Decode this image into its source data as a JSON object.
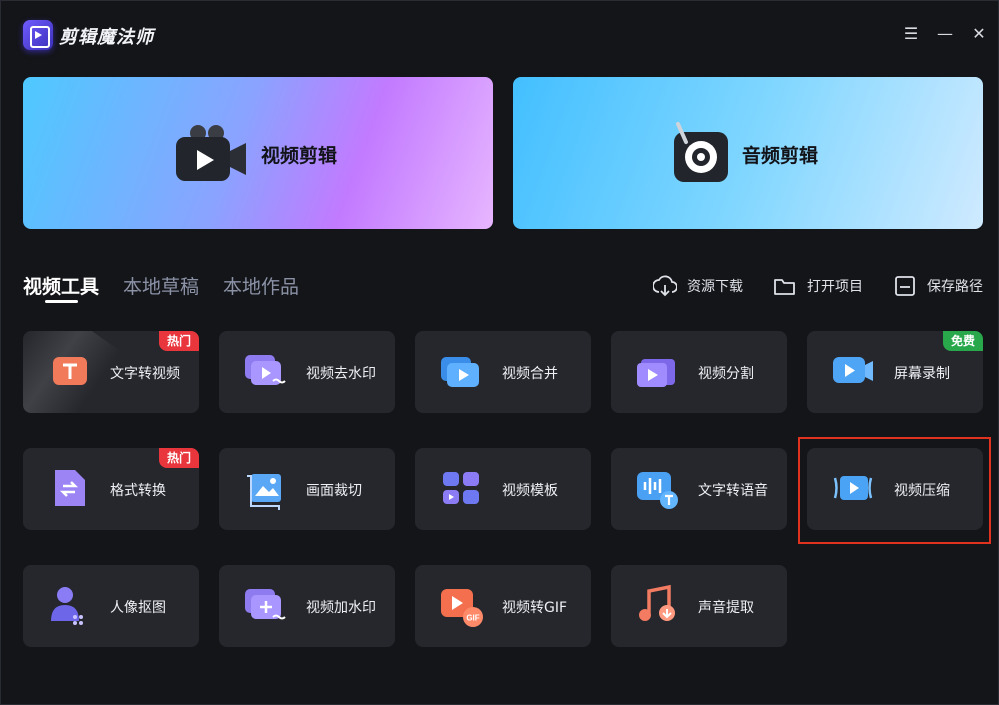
{
  "app": {
    "title": "剪辑魔法师"
  },
  "window_controls": {
    "menu": "☰",
    "minimize": "—",
    "close": "✕"
  },
  "banners": [
    {
      "label": "视频剪辑",
      "icon": "video-camera-icon"
    },
    {
      "label": "音频剪辑",
      "icon": "audio-disc-icon"
    }
  ],
  "tabs": [
    {
      "label": "视频工具",
      "active": true
    },
    {
      "label": "本地草稿",
      "active": false
    },
    {
      "label": "本地作品",
      "active": false
    }
  ],
  "actions": [
    {
      "label": "资源下载",
      "icon": "download-icon"
    },
    {
      "label": "打开项目",
      "icon": "folder-icon"
    },
    {
      "label": "保存路径",
      "icon": "save-icon"
    }
  ],
  "tools": [
    {
      "label": "文字转视频",
      "badge": "热门",
      "icon": "text-to-video-icon"
    },
    {
      "label": "视频去水印",
      "badge": "",
      "icon": "remove-watermark-icon"
    },
    {
      "label": "视频合并",
      "badge": "",
      "icon": "video-merge-icon"
    },
    {
      "label": "视频分割",
      "badge": "",
      "icon": "video-split-icon"
    },
    {
      "label": "屏幕录制",
      "badge": "免费",
      "icon": "screen-record-icon"
    },
    {
      "label": "格式转换",
      "badge": "热门",
      "icon": "format-convert-icon"
    },
    {
      "label": "画面裁切",
      "badge": "",
      "icon": "crop-icon"
    },
    {
      "label": "视频模板",
      "badge": "",
      "icon": "video-template-icon"
    },
    {
      "label": "文字转语音",
      "badge": "",
      "icon": "text-to-speech-icon"
    },
    {
      "label": "视频压缩",
      "badge": "",
      "icon": "video-compress-icon"
    },
    {
      "label": "人像抠图",
      "badge": "",
      "icon": "portrait-cutout-icon"
    },
    {
      "label": "视频加水印",
      "badge": "",
      "icon": "add-watermark-icon"
    },
    {
      "label": "视频转GIF",
      "badge": "",
      "icon": "video-to-gif-icon"
    },
    {
      "label": "声音提取",
      "badge": "",
      "icon": "audio-extract-icon"
    }
  ],
  "colors": {
    "hot_badge": "#e8363c",
    "free_badge": "#28a74b",
    "highlight": "#e0321e",
    "accent": "#4aa8ff"
  }
}
